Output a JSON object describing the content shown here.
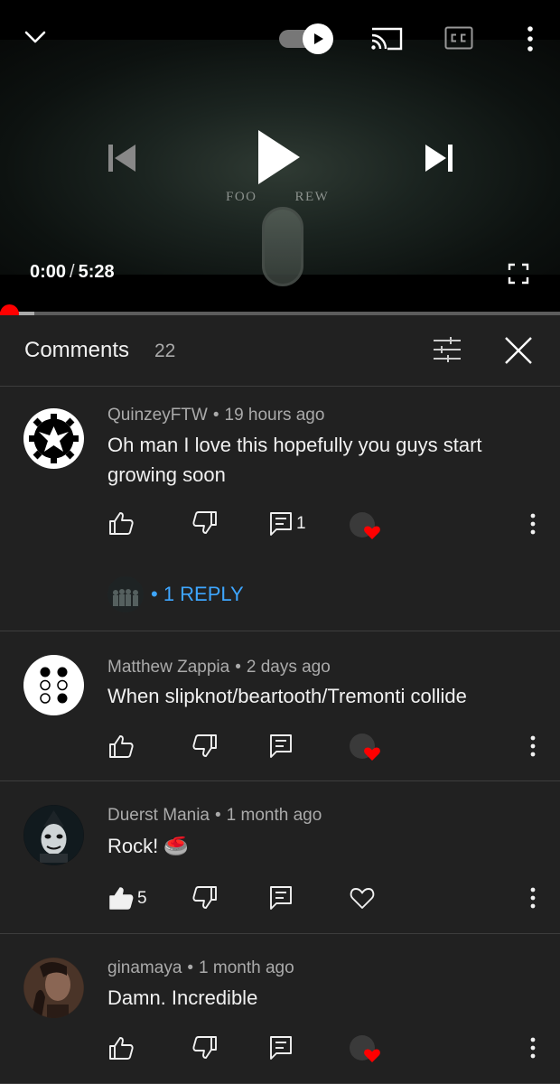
{
  "player": {
    "video_title_left": "FOO",
    "video_title_right": "REW",
    "time_current": "0:00",
    "time_separator": "/",
    "time_total": "5:28",
    "progress_fraction": 0,
    "accent_color": "#ff0000"
  },
  "comments_panel": {
    "title": "Comments",
    "count": "22"
  },
  "comments": [
    {
      "author": "QuinzeyFTW",
      "age": "19 hours ago",
      "text": "Oh man I love this hopefully you guys start growing soon",
      "likes": "",
      "replies_count": "1",
      "creator_hearted": true,
      "reply_link": "• 1 REPLY"
    },
    {
      "author": "Matthew Zappia",
      "age": "2 days ago",
      "text": "When slipknot/beartooth/Tremonti collide",
      "likes": "",
      "creator_hearted": true
    },
    {
      "author": "Duerst Mania",
      "age": "1 month ago",
      "text": "Rock! 🥌",
      "likes": "5",
      "liked": true,
      "creator_hearted": false
    },
    {
      "author": "ginamaya",
      "age": "1 month ago",
      "text": "Damn. Incredible",
      "likes": "",
      "creator_hearted": true
    }
  ],
  "meta_separator": "•",
  "icons": {
    "chevron": "chevron-down-icon",
    "autoplay": "autoplay-toggle",
    "cast": "cast-icon",
    "captions": "closed-captions-icon",
    "more": "more-vertical-icon",
    "previous": "skip-previous-icon",
    "play": "play-icon",
    "next": "skip-next-icon",
    "fullscreen": "fullscreen-icon",
    "filter": "sort-filter-icon",
    "close": "close-icon",
    "like": "thumb-up-icon",
    "dislike": "thumb-down-icon",
    "reply": "reply-icon",
    "heart": "heart-icon"
  }
}
